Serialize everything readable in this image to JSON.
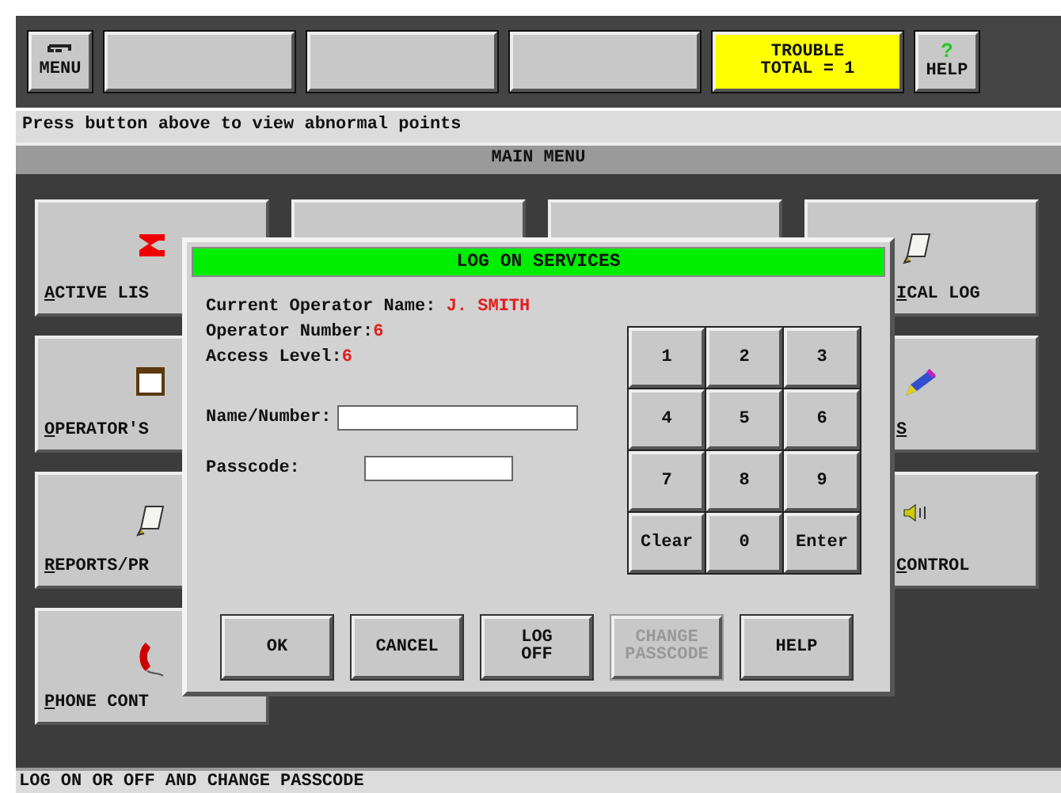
{
  "top_buttons": [
    {
      "kind": "menu",
      "label": "MENU"
    },
    {
      "kind": "blank"
    },
    {
      "kind": "blank"
    },
    {
      "kind": "blank"
    },
    {
      "kind": "alert",
      "label": "TROUBLE\nTOTAL = 1"
    },
    {
      "kind": "help",
      "icon": "?",
      "label": "HELP"
    }
  ],
  "message": "Press button above to view abnormal points",
  "menu_title": "MAIN MENU",
  "tiles": [
    {
      "kind": "alarm",
      "label": "ACTIVE LIS"
    },
    {
      "kind": "hidden"
    },
    {
      "kind": "hidden"
    },
    {
      "kind": "scroll",
      "label": "ICAL LOG"
    },
    {
      "kind": "calendar",
      "label": "OPERATOR'S"
    },
    {
      "kind": "pencil",
      "label": "S"
    },
    {
      "kind": "scroll",
      "label": "REPORTS/PR"
    },
    {
      "kind": "speaker",
      "label": "CONTROL"
    },
    {
      "kind": "phone",
      "label": "PHONE CONT"
    }
  ],
  "dialog": {
    "title": "LOG ON SERVICES",
    "info": [
      {
        "label": "Current Operator Name: ",
        "value": "J. SMITH"
      },
      {
        "label": "Operator Number:",
        "value": "6"
      },
      {
        "label": "Access Level:",
        "value": "6"
      }
    ],
    "fields": [
      {
        "label": "Name/Number:"
      },
      {
        "label": "Passcode:"
      }
    ],
    "keypad": [
      "1",
      "2",
      "3",
      "4",
      "5",
      "6",
      "7",
      "8",
      "9",
      "Clear",
      "0",
      "Enter"
    ],
    "buttons": [
      {
        "label": "OK",
        "disabled": false
      },
      {
        "label": "CANCEL",
        "disabled": false
      },
      {
        "label": "LOG\nOFF",
        "disabled": false
      },
      {
        "label": "CHANGE\nPASSCODE",
        "disabled": true
      },
      {
        "label": "HELP",
        "disabled": false
      }
    ]
  },
  "status_bar": "LOG ON OR OFF AND CHANGE PASSCODE"
}
